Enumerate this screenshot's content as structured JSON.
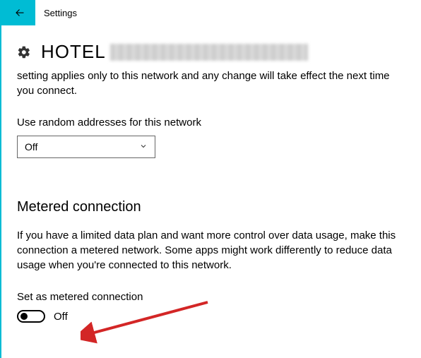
{
  "header": {
    "title": "Settings"
  },
  "network": {
    "name": "HOTEL",
    "description": "setting applies only to this network and any change will take effect the next time you connect."
  },
  "randomAddresses": {
    "label": "Use random addresses for this network",
    "value": "Off"
  },
  "metered": {
    "heading": "Metered connection",
    "description": "If you have a limited data plan and want more control over data usage, make this connection a metered network. Some apps might work differently to reduce data usage when you're connected to this network.",
    "toggleLabel": "Set as metered connection",
    "toggleValue": "Off"
  }
}
